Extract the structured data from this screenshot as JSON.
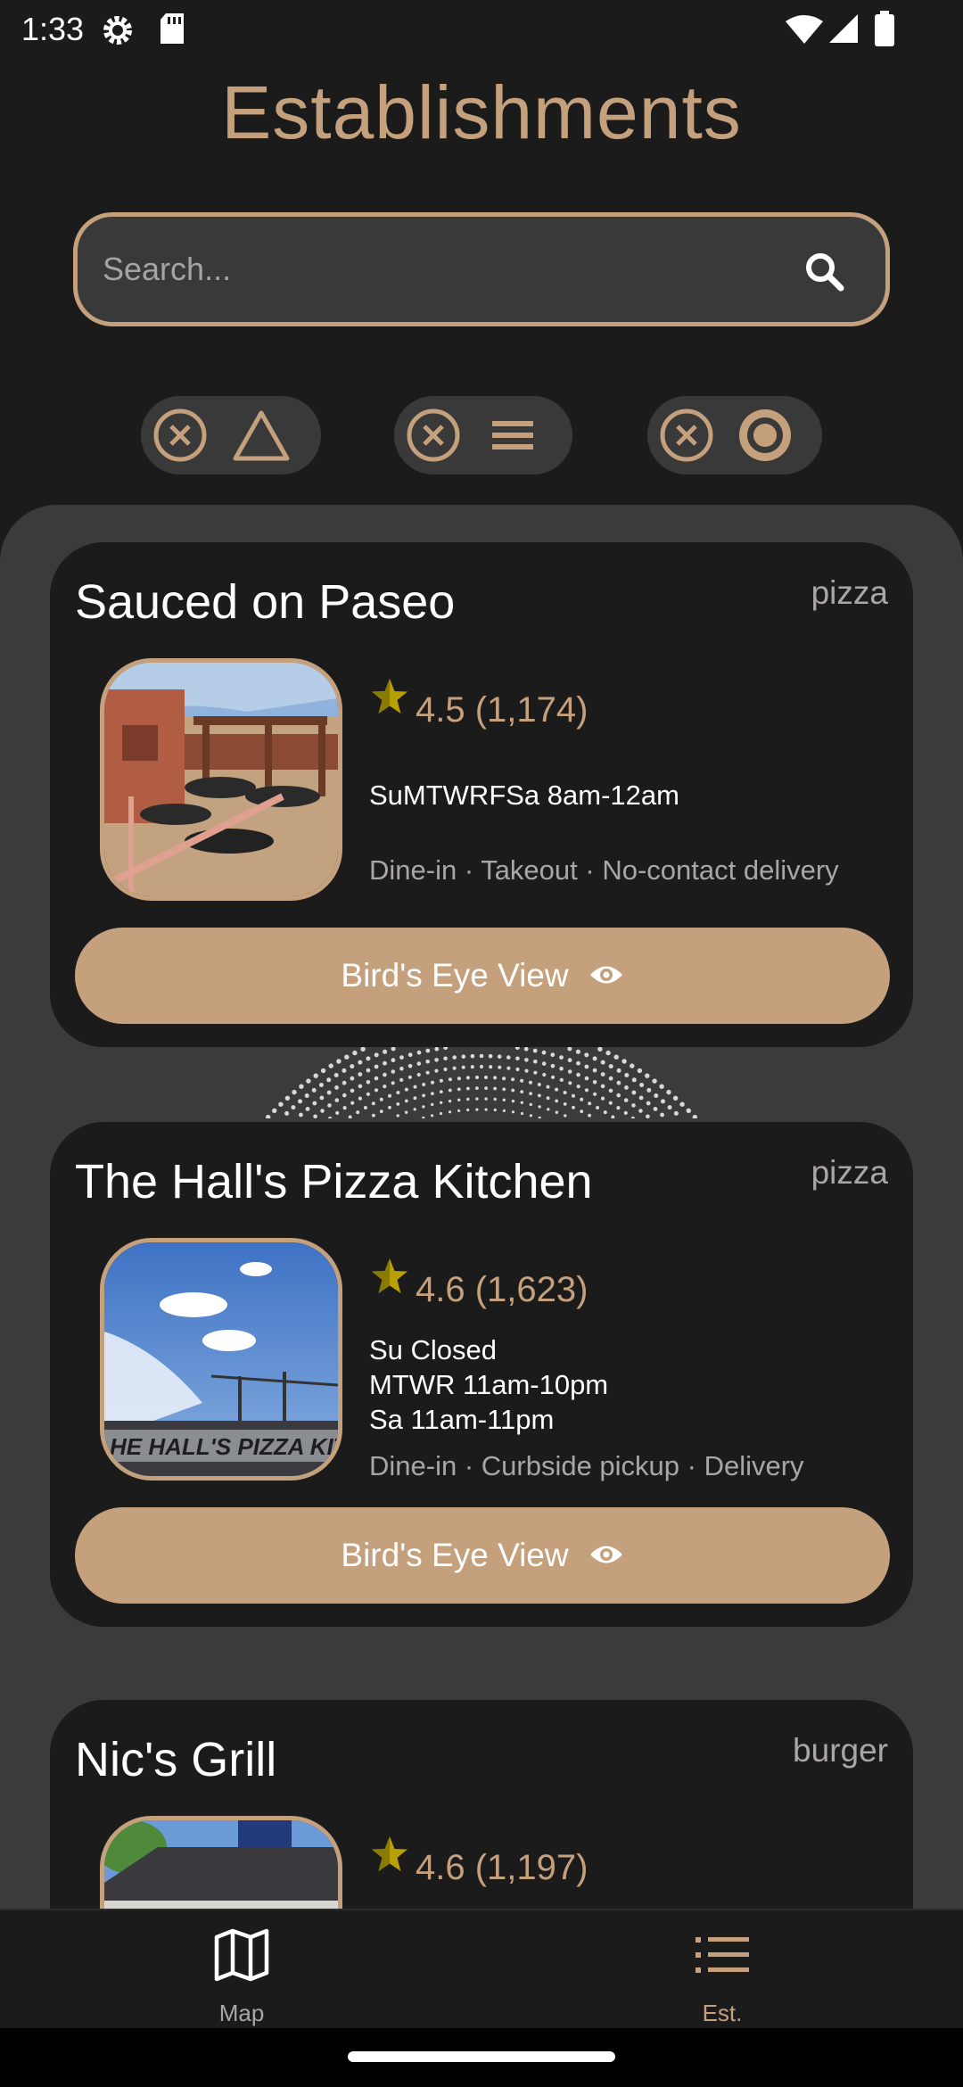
{
  "status_bar": {
    "time": "1:33",
    "icons": [
      "settings-gear-icon",
      "sd-card-icon",
      "wifi-icon",
      "cellular-signal-icon",
      "battery-icon"
    ]
  },
  "title": "Establishments",
  "search": {
    "placeholder": "Search..."
  },
  "filters": [
    {
      "clear_icon": "circle-x-icon",
      "symbol_icon": "triangle-icon"
    },
    {
      "clear_icon": "circle-x-icon",
      "symbol_icon": "hamburger-lines-icon"
    },
    {
      "clear_icon": "circle-x-icon",
      "symbol_icon": "concentric-circles-icon"
    }
  ],
  "establishments": [
    {
      "name": "Sauced on Paseo",
      "category": "pizza",
      "rating": "4.5 (1,174)",
      "hours": [
        "SuMTWRFSa 8am-12am"
      ],
      "services": "Dine-in · Takeout · No-contact delivery",
      "button": "Bird's Eye View"
    },
    {
      "name": "The Hall's Pizza Kitchen",
      "category": "pizza",
      "rating": "4.6 (1,623)",
      "hours": [
        "Su Closed",
        "MTWR 11am-10pm",
        "Sa 11am-11pm"
      ],
      "services": "Dine-in · Curbside pickup · Delivery",
      "button": "Bird's Eye View",
      "photo_sign": "HE HALL'S PIZZA KITCH"
    },
    {
      "name": "Nic's Grill",
      "category": "burger",
      "rating": "4.6 (1,197)"
    }
  ],
  "bottom_nav": [
    {
      "label": "Map",
      "icon": "map-icon"
    },
    {
      "label": "Est.",
      "icon": "list-icon"
    }
  ],
  "colors": {
    "accent": "#c4a07c",
    "background": "#1c1b1c",
    "panel": "#3c3b3c",
    "star": "#b8a000"
  }
}
